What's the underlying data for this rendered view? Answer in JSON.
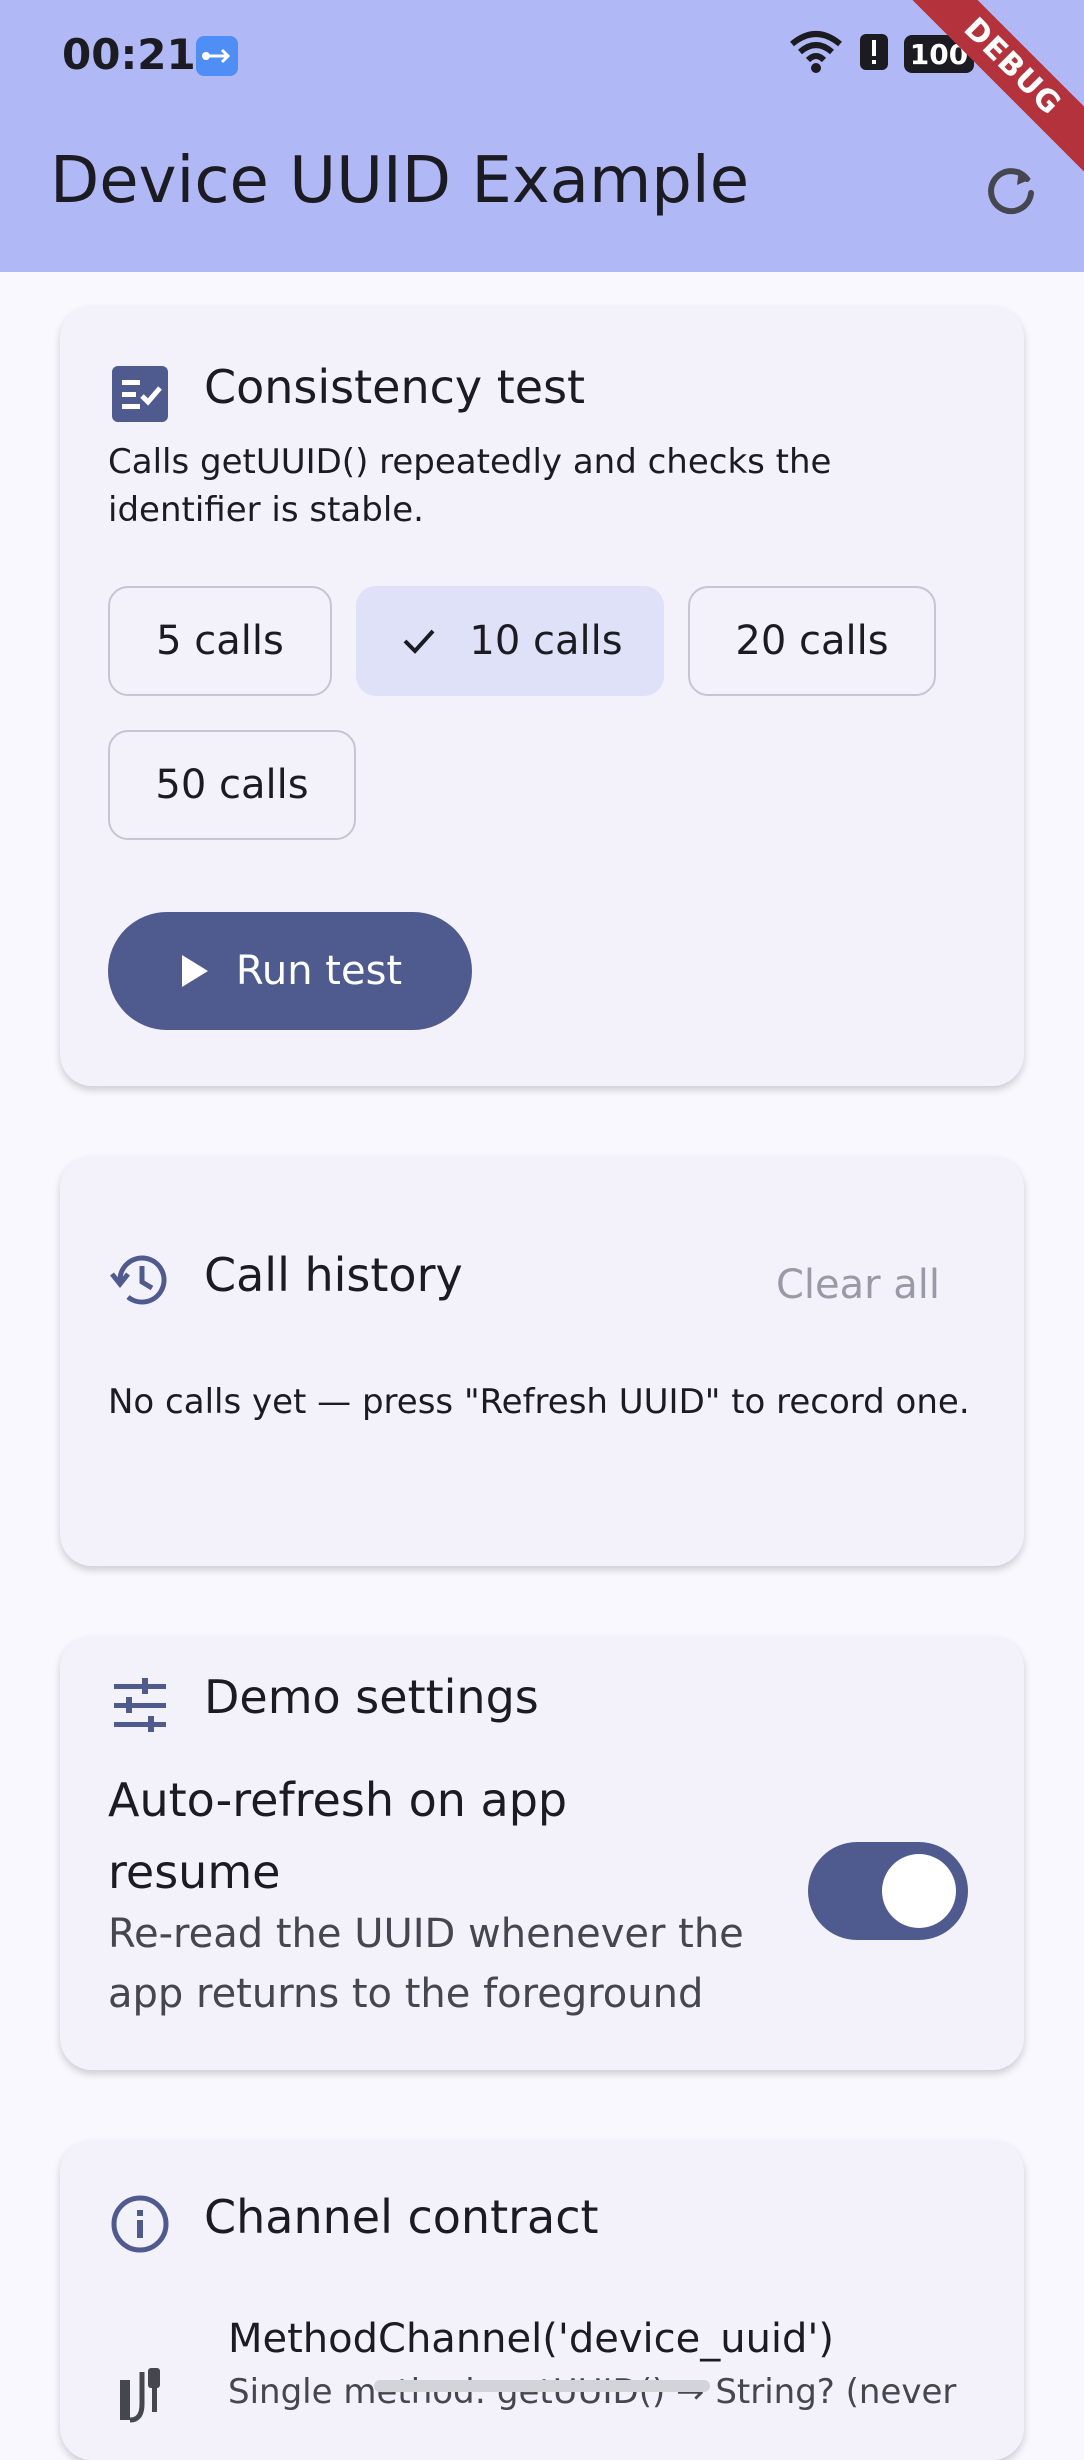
{
  "status_bar": {
    "time": "00:21",
    "battery": "100"
  },
  "debug_banner": "DEBUG",
  "app_bar": {
    "title": "Device UUID Example"
  },
  "consistency_test": {
    "title": "Consistency test",
    "description": "Calls getUUID() repeatedly and checks the identifier is stable.",
    "chips": [
      {
        "label": "5 calls",
        "selected": false
      },
      {
        "label": "10 calls",
        "selected": true
      },
      {
        "label": "20 calls",
        "selected": false
      },
      {
        "label": "50 calls",
        "selected": false
      }
    ],
    "run_label": "Run test"
  },
  "call_history": {
    "title": "Call history",
    "clear_label": "Clear all",
    "empty_message": "No calls yet — press \"Refresh UUID\" to record one."
  },
  "demo_settings": {
    "title": "Demo settings",
    "setting_title": "Auto-refresh on app resume",
    "setting_desc": "Re-read the UUID whenever the app returns to the foreground",
    "toggle_on": true
  },
  "channel_contract": {
    "title": "Channel contract",
    "channel_name": "MethodChannel('device_uuid')",
    "channel_desc": "Single method: getUUID() → String? (never"
  },
  "colors": {
    "app_bar": "#b1b8f6",
    "primary": "#4f5a8f",
    "chip_selected": "#dfe1f9"
  }
}
